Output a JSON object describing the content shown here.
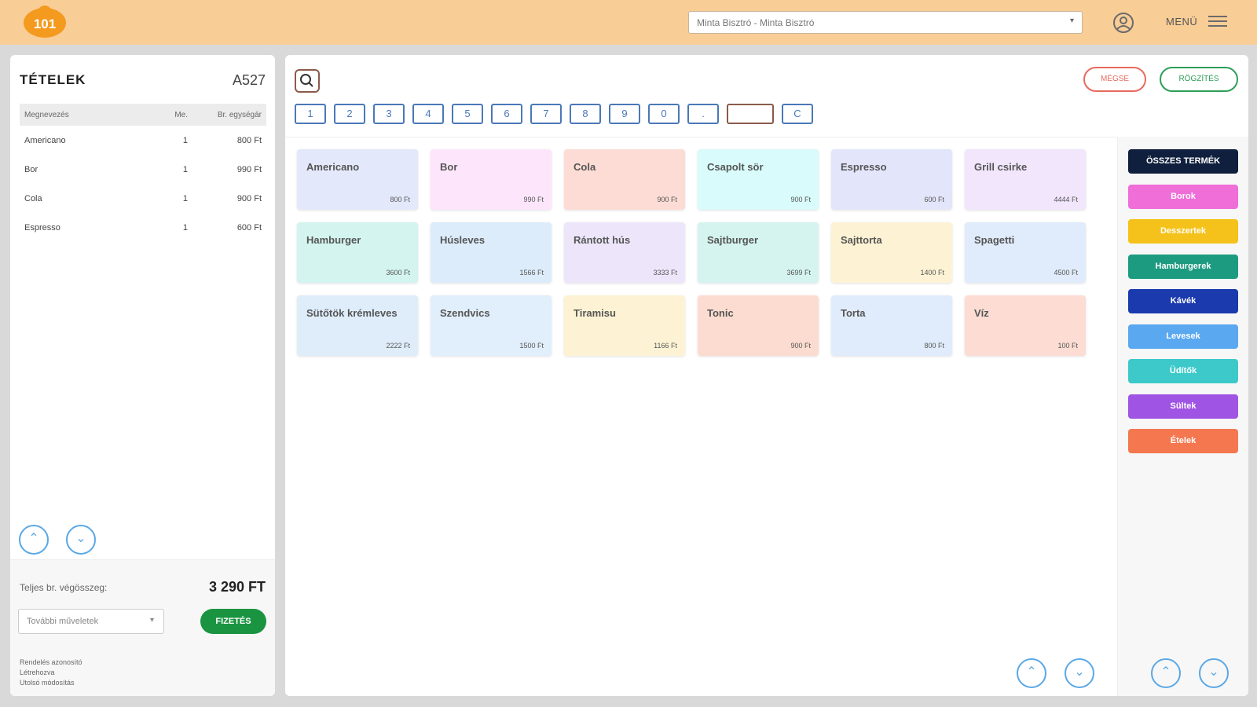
{
  "header": {
    "venue": "Minta Bisztró - Minta Bisztró",
    "menu_label": "MENÜ"
  },
  "items_panel": {
    "title": "TÉTELEK",
    "code": "A527",
    "columns": [
      "Megnevezés",
      "Me.",
      "Br. egységár"
    ],
    "rows": [
      {
        "name": "Americano",
        "qty": "1",
        "price": "800 Ft"
      },
      {
        "name": "Bor",
        "qty": "1",
        "price": "990 Ft"
      },
      {
        "name": "Cola",
        "qty": "1",
        "price": "900 Ft"
      },
      {
        "name": "Espresso",
        "qty": "1",
        "price": "600 Ft"
      }
    ],
    "total_label": "Teljes br. végösszeg:",
    "total_value": "3 290 FT",
    "more_actions": "További műveletek",
    "pay_label": "FIZETÉS",
    "footer_links": [
      "Rendelés azonosító",
      "Létrehozva",
      "Utolsó módosítás"
    ]
  },
  "actions": {
    "cancel": "MÉGSE",
    "save": "RÖGZÍTÉS"
  },
  "numpad": [
    "1",
    "2",
    "3",
    "4",
    "5",
    "6",
    "7",
    "8",
    "9",
    "0",
    ".",
    "",
    "C"
  ],
  "products": [
    {
      "name": "Americano",
      "price": "800 Ft",
      "color": "#e4e8fb"
    },
    {
      "name": "Bor",
      "price": "990 Ft",
      "color": "#fde6fb"
    },
    {
      "name": "Cola",
      "price": "900 Ft",
      "color": "#fcdcd4"
    },
    {
      "name": "Csapolt sör",
      "price": "900 Ft",
      "color": "#d9fbfb"
    },
    {
      "name": "Espresso",
      "price": "600 Ft",
      "color": "#e3e5fb"
    },
    {
      "name": "Grill csirke",
      "price": "4444 Ft",
      "color": "#f1e6fb"
    },
    {
      "name": "Hamburger",
      "price": "3600 Ft",
      "color": "#d3f4ef"
    },
    {
      "name": "Húsleves",
      "price": "1566 Ft",
      "color": "#dcecfb"
    },
    {
      "name": "Rántott hús",
      "price": "3333 Ft",
      "color": "#ede6fb"
    },
    {
      "name": "Sajtburger",
      "price": "3699 Ft",
      "color": "#d5f4ef"
    },
    {
      "name": "Sajttorta",
      "price": "1400 Ft",
      "color": "#fdf3d4"
    },
    {
      "name": "Spagetti",
      "price": "4500 Ft",
      "color": "#e0ecfb"
    },
    {
      "name": "Sütőtök krémleves",
      "price": "2222 Ft",
      "color": "#dfedfb"
    },
    {
      "name": "Szendvics",
      "price": "1500 Ft",
      "color": "#e1eefb"
    },
    {
      "name": "Tiramisu",
      "price": "1166 Ft",
      "color": "#fdf3d4"
    },
    {
      "name": "Tonic",
      "price": "900 Ft",
      "color": "#fcdcd0"
    },
    {
      "name": "Torta",
      "price": "800 Ft",
      "color": "#e0ecfb"
    },
    {
      "name": "Víz",
      "price": "100 Ft",
      "color": "#fcdcd3"
    }
  ],
  "categories": [
    {
      "label": "ÖSSZES TERMÉK",
      "color": "#0f1f3d"
    },
    {
      "label": "Borok",
      "color": "#ef6ed8"
    },
    {
      "label": "Desszertek",
      "color": "#f5c21b"
    },
    {
      "label": "Hamburgerek",
      "color": "#1d9b80"
    },
    {
      "label": "Kávék",
      "color": "#1a3aad"
    },
    {
      "label": "Levesek",
      "color": "#5aa8f0"
    },
    {
      "label": "Üdítők",
      "color": "#3dc9c9"
    },
    {
      "label": "Sültek",
      "color": "#9f54e4"
    },
    {
      "label": "Ételek",
      "color": "#f4774f"
    }
  ]
}
